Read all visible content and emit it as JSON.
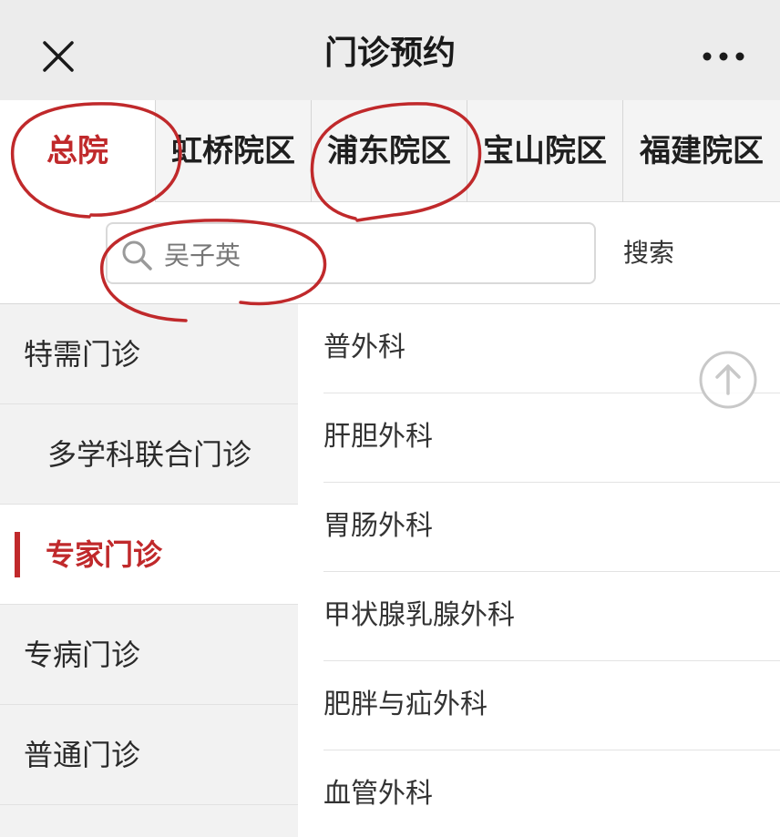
{
  "header": {
    "title": "门诊预约",
    "close_icon": "close-icon",
    "more_icon": "more-icon"
  },
  "tabs": [
    {
      "label": "总院",
      "active": true
    },
    {
      "label": "虹桥院区",
      "active": false
    },
    {
      "label": "浦东院区",
      "active": false
    },
    {
      "label": "宝山院区",
      "active": false
    },
    {
      "label": "福建院区",
      "active": false
    }
  ],
  "search": {
    "value": "吴子英",
    "button_label": "搜索",
    "icon": "search-icon"
  },
  "sidebar": {
    "items": [
      {
        "label": "特需门诊",
        "active": false
      },
      {
        "label": "多学科联合门诊",
        "active": false
      },
      {
        "label": "专家门诊",
        "active": true
      },
      {
        "label": "专病门诊",
        "active": false
      },
      {
        "label": "普通门诊",
        "active": false
      }
    ]
  },
  "departments": [
    {
      "label": "普外科"
    },
    {
      "label": "肝胆外科"
    },
    {
      "label": "胃肠外科"
    },
    {
      "label": "甲状腺乳腺外科"
    },
    {
      "label": "肥胖与疝外科"
    },
    {
      "label": "血管外科"
    }
  ],
  "scroll_top_icon": "arrow-up-circle-icon",
  "colors": {
    "accent": "#c0292b",
    "annotation": "#c0292b",
    "titlebar_bg": "#ececec",
    "sidebar_bg": "#f2f2f2"
  }
}
